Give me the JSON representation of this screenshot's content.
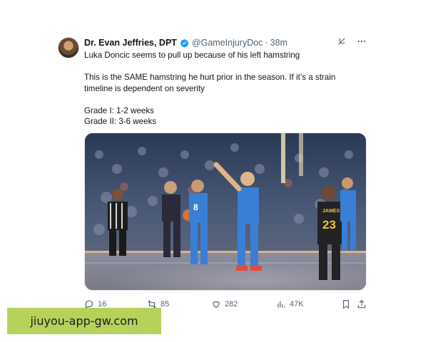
{
  "tweet": {
    "author_name": "Dr. Evan Jeffries, DPT",
    "handle": "@GameInjuryDoc",
    "separator": "·",
    "time": "38m",
    "lines": [
      "Luka Doncic seems to pull up because of his left hamstring",
      "",
      "This is the SAME hamstring he hurt prior in the season. If it’s a strain",
      "timeline is dependent on severity",
      "",
      "Grade I: 1-2 weeks",
      "Grade II: 3-6 weeks"
    ],
    "media": {
      "description_icon": "basketball-game-image",
      "jersey_left": "8",
      "jersey_right_name": "JAMES",
      "jersey_right_number": "23"
    }
  },
  "actions": {
    "replies": "16",
    "retweets": "85",
    "likes": "282",
    "views": "47K"
  },
  "overlay": {
    "watermark_text": "jiuyou-app-gw.com",
    "watermark_color": "#b6d25a"
  },
  "colors": {
    "verified": "#1d9bf0",
    "muted": "#536471",
    "text": "#0f1419"
  }
}
